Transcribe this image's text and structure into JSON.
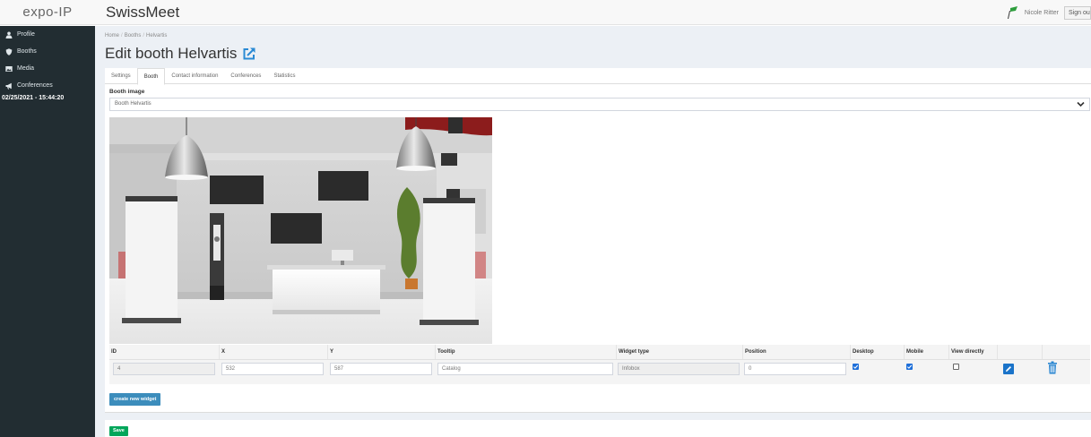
{
  "brand": "expo-IP",
  "app_title": "SwissMeet",
  "user": {
    "name": "Nicole Ritter",
    "signout_label": "Sign out"
  },
  "sidebar": {
    "items": [
      {
        "label": "Profile",
        "icon": "user-icon"
      },
      {
        "label": "Booths",
        "icon": "shield-icon"
      },
      {
        "label": "Media",
        "icon": "image-icon"
      },
      {
        "label": "Conferences",
        "icon": "megaphone-icon"
      }
    ],
    "datetime": "02/25/2021 - 15:44:20"
  },
  "breadcrumb": [
    "Home",
    "Booths",
    "Helvartis"
  ],
  "page": {
    "title": "Edit booth Helvartis"
  },
  "tabs": [
    "Settings",
    "Booth",
    "Contact information",
    "Conferences",
    "Statistics"
  ],
  "active_tab": "Booth",
  "booth_image": {
    "label": "Booth image",
    "selected": "Booth Helvartis"
  },
  "widgets": {
    "columns": [
      "ID",
      "X",
      "Y",
      "Tooltip",
      "Widget type",
      "Position",
      "Desktop",
      "Mobile",
      "View directly",
      "",
      ""
    ],
    "rows": [
      {
        "id": "4",
        "x": "532",
        "y": "587",
        "tooltip": "Catalog",
        "widget_type": "Infobox",
        "position": "0",
        "desktop": true,
        "mobile": true,
        "view_directly": false
      }
    ]
  },
  "buttons": {
    "create_widget": "create new widget",
    "save": "Save"
  },
  "colors": {
    "sidebar": "#222d32",
    "primary": "#3c8dbc",
    "success": "#00a65a",
    "content_bg": "#ecf0f5"
  }
}
